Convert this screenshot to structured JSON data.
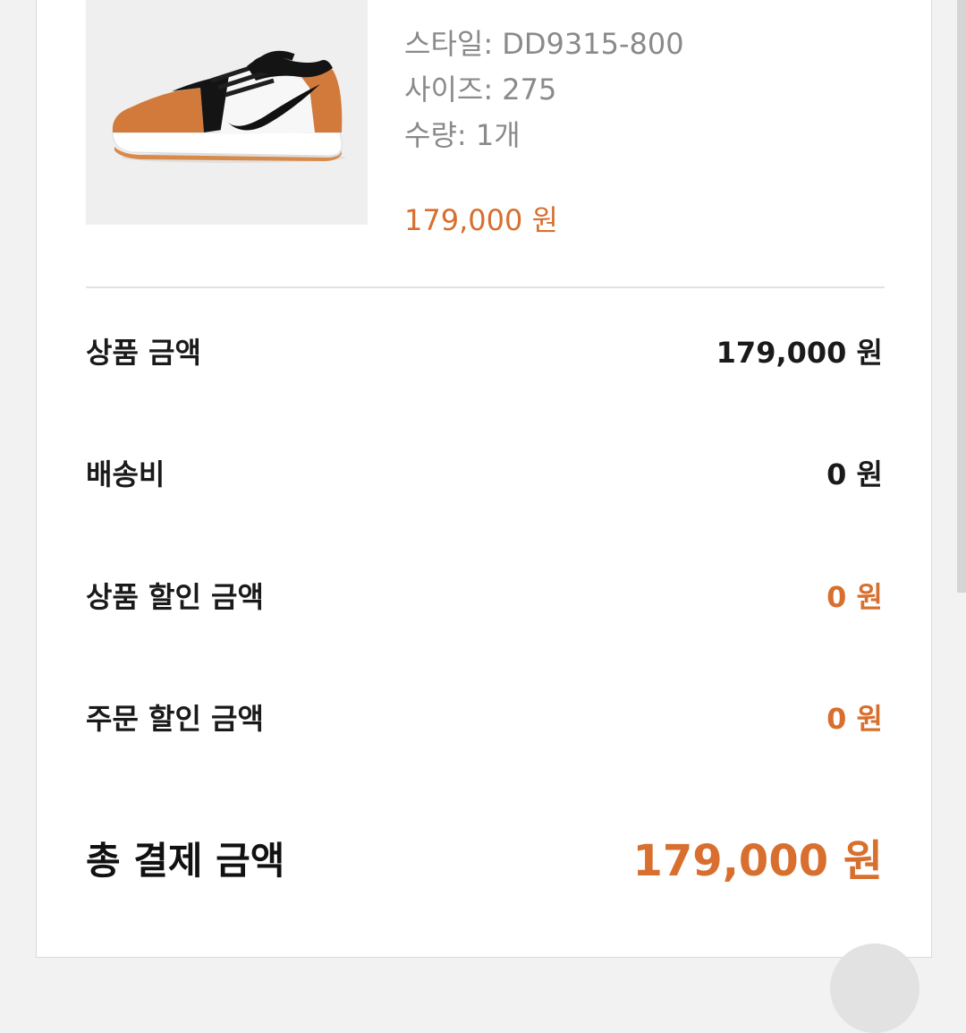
{
  "product": {
    "image": "Nike Air Jordan 1 Low golf shoe, black / orange / white",
    "style": "스타일: DD9315-800",
    "size": "사이즈: 275",
    "quantity": "수량: 1개",
    "price": "179,000 원"
  },
  "summary": {
    "rows": [
      {
        "label": "상품 금액",
        "value": "179,000 원"
      },
      {
        "label": "배송비",
        "value": "0 원"
      },
      {
        "label": "상품 할인 금액",
        "value": "0 원"
      },
      {
        "label": "주문 할인 금액",
        "value": "0 원"
      }
    ],
    "total": {
      "label": "총 결제 금액",
      "value": "179,000 원"
    }
  },
  "colors": {
    "accent": "#d86f2e",
    "text": "#1a1a1a",
    "muted": "#8a8a8a"
  }
}
